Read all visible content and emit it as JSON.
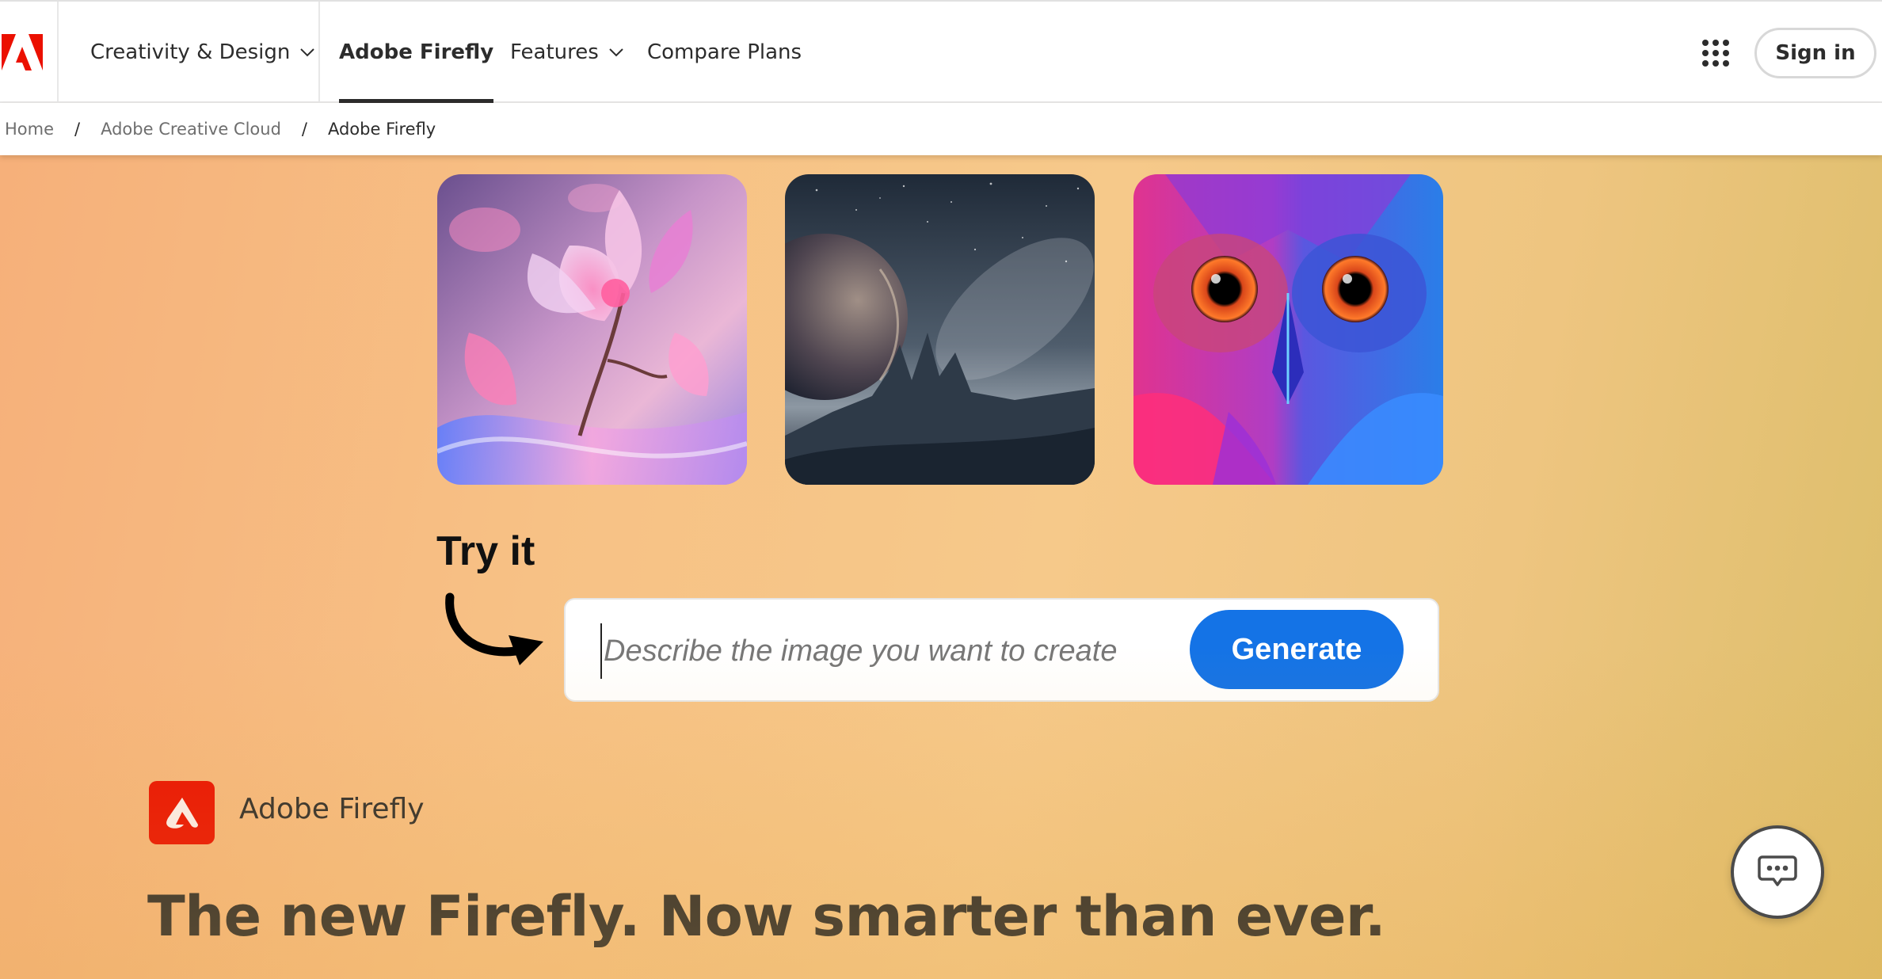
{
  "header": {
    "logo_label": "Adobe",
    "nav": [
      {
        "label": "Creativity & Design",
        "has_dropdown": true,
        "active": false
      },
      {
        "label": "Adobe Firefly",
        "has_dropdown": false,
        "active": true
      },
      {
        "label": "Features",
        "has_dropdown": true,
        "active": false
      },
      {
        "label": "Compare Plans",
        "has_dropdown": false,
        "active": false
      }
    ],
    "apps_icon": "app-grid-icon",
    "sign_in_label": "Sign in"
  },
  "breadcrumb": [
    {
      "label": "Home"
    },
    {
      "label": "Adobe Creative Cloud"
    },
    {
      "label": "Adobe Firefly",
      "current": true
    }
  ],
  "breadcrumb_separator": "/",
  "hero": {
    "gallery": [
      {
        "subject": "pink crystal flower"
      },
      {
        "subject": "moon over mountain peaks"
      },
      {
        "subject": "colorful owl portrait"
      }
    ],
    "try_it_label": "Try it",
    "prompt": {
      "value": "",
      "placeholder": "Describe the image you want to create"
    },
    "generate_label": "Generate",
    "app_name": "Adobe Firefly",
    "headline": "The new Firefly. Now smarter than ever."
  },
  "colors": {
    "adobe_red": "#eb1000",
    "generate_blue": "#1473e6",
    "text_dark": "#2c2c2c",
    "bg_gradient_start": "#f6b07a",
    "bg_gradient_end": "#dcbe6a"
  },
  "chat_icon": "chat-bubble-icon"
}
